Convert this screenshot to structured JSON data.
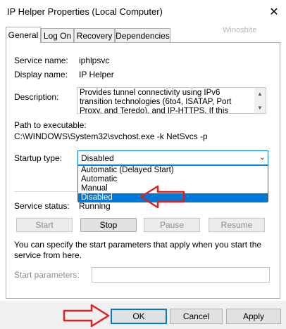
{
  "window": {
    "title": "IP Helper Properties (Local Computer)"
  },
  "tabs": [
    {
      "label": "General"
    },
    {
      "label": "Log On"
    },
    {
      "label": "Recovery"
    },
    {
      "label": "Dependencies"
    }
  ],
  "watermark": "Winosbite",
  "service": {
    "name_label": "Service name:",
    "name_value": "iphlpsvc",
    "display_label": "Display name:",
    "display_value": "IP Helper",
    "description_label": "Description:",
    "description_value": "Provides tunnel connectivity using IPv6 transition technologies (6to4, ISATAP, Port Proxy, and Teredo), and IP-HTTPS. If this service is stopped",
    "path_label": "Path to executable:",
    "path_value": "C:\\WINDOWS\\System32\\svchost.exe -k NetSvcs -p",
    "startup_label": "Startup type:",
    "startup_value": "Disabled",
    "startup_options": [
      "Automatic (Delayed Start)",
      "Automatic",
      "Manual",
      "Disabled"
    ],
    "status_label": "Service status:",
    "status_value": "Running"
  },
  "controls": {
    "start": "Start",
    "stop": "Stop",
    "pause": "Pause",
    "resume": "Resume"
  },
  "help_text": "You can specify the start parameters that apply when you start the service from here.",
  "params": {
    "label": "Start parameters:",
    "value": ""
  },
  "footer": {
    "ok": "OK",
    "cancel": "Cancel",
    "apply": "Apply"
  },
  "colors": {
    "accent": "#0078d7",
    "annotation_arrow": "#e02020"
  }
}
